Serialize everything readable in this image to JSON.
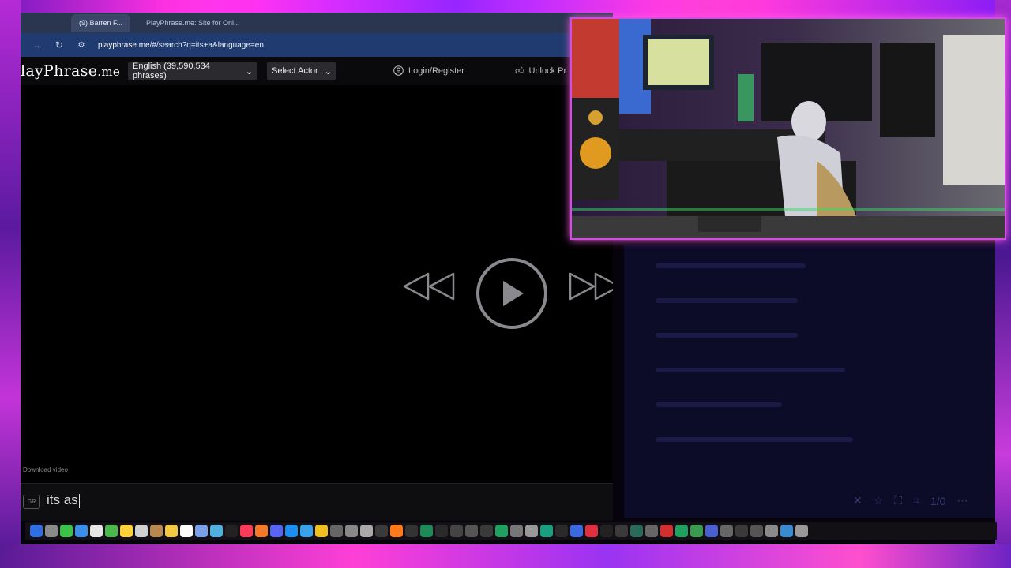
{
  "browser": {
    "tabs": [
      {
        "label": "(9) Barren F...",
        "active": true
      },
      {
        "label": "PlayPhrase.me: Site for Onl...",
        "active": false
      }
    ],
    "url_host": "playphrase.me",
    "url_path": "/#/search?q=its+a&language=en"
  },
  "site": {
    "logo_main": "layPhrase",
    "logo_tld": ".me",
    "language_select": "English (39,590,534 phrases)",
    "actor_select": "Select Actor",
    "login_label": "Login/Register",
    "unlock_label": "Unlock Pr"
  },
  "player": {
    "download_label": "Download video"
  },
  "search": {
    "badge": "GR",
    "query": "its as"
  },
  "right_panel": {
    "counter": "1/0"
  }
}
